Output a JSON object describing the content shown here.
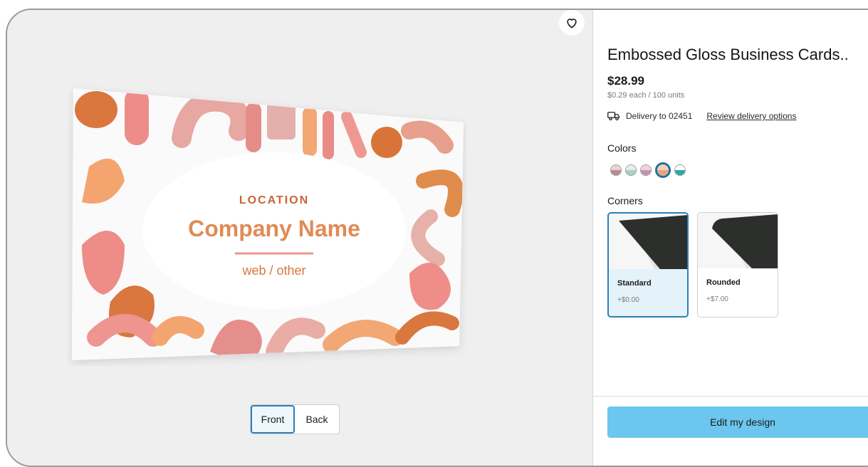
{
  "product": {
    "title": "Embossed Gloss Business Cards..",
    "price": "$28.99",
    "unit_price": "$0.29 each / 100 units"
  },
  "delivery": {
    "icon": "truck-icon",
    "text": "Delivery to 02451",
    "link": "Review delivery options"
  },
  "colors": {
    "label": "Colors",
    "swatches": [
      {
        "top": "#e9d3d6",
        "bottom": "#b98a90"
      },
      {
        "top": "#e3efe9",
        "bottom": "#a8d2c2"
      },
      {
        "top": "#f0d3e3",
        "bottom": "#cc8fb0"
      },
      {
        "top": "#f6d0b4",
        "bottom": "#e7a57d"
      },
      {
        "top": "#ffffff",
        "bottom": "#2aa7b0"
      }
    ],
    "selected_index": 3
  },
  "corners": {
    "label": "Corners",
    "options": [
      {
        "name": "Standard",
        "price": "+$0.00",
        "selected": true
      },
      {
        "name": "Rounded",
        "price": "+$7.00",
        "selected": false
      }
    ]
  },
  "preview": {
    "card_location": "LOCATION",
    "card_company": "Company Name",
    "card_web": "web / other",
    "faces": [
      "Front",
      "Back"
    ],
    "active_face": "Front",
    "favorite_icon": "heart-icon"
  },
  "actions": {
    "edit_label": "Edit my design"
  },
  "palette": {
    "accent": "#6cc6ee",
    "selected_border": "#2c7fb8",
    "card_text": "#d4875a"
  }
}
